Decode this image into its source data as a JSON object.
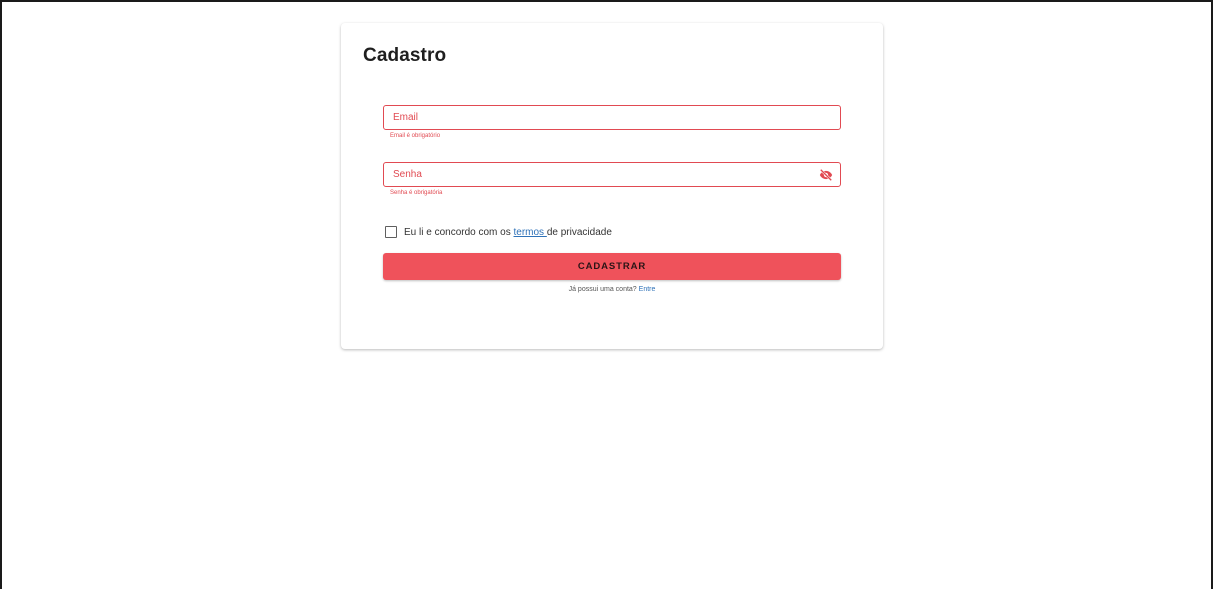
{
  "form": {
    "title": "Cadastro",
    "email": {
      "label": "Email",
      "value": "",
      "error": "Email é obrigatório"
    },
    "password": {
      "label": "Senha",
      "value": "",
      "error": "Senha é obrigatória",
      "toggle_icon": "eye-off-icon"
    },
    "terms": {
      "checked": false,
      "text_before": "Eu li e concordo com os ",
      "link": "termos ",
      "text_after": "de privacidade"
    },
    "submit_label": "CADASTRAR",
    "login_prompt": {
      "text": "Já possui uma conta?",
      "link": "Entre"
    }
  },
  "colors": {
    "error": "#e14a52",
    "button": "#ef525b",
    "link": "#2f72b8"
  }
}
